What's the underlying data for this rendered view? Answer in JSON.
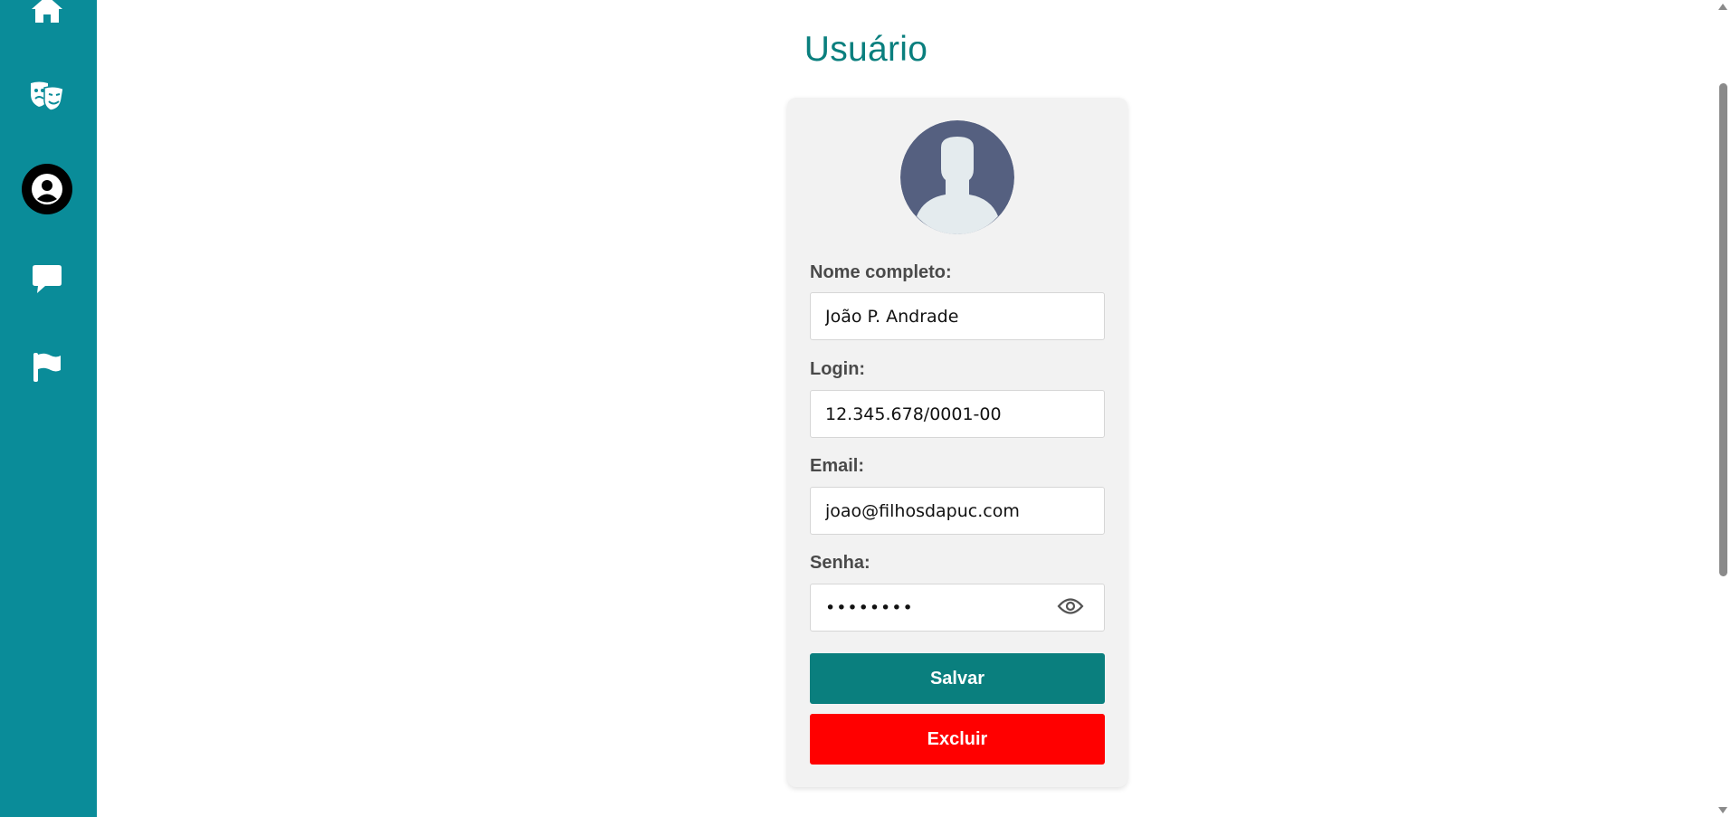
{
  "colors": {
    "sidebar": "#0a8c99",
    "accent": "#0a7f7e",
    "danger": "#ff0000",
    "card": "#f2f2f2",
    "avatar_bg": "#556080",
    "avatar_figure": "#e4ebee"
  },
  "sidebar": {
    "items": [
      {
        "icon": "home-icon",
        "active": false
      },
      {
        "icon": "theater-masks-icon",
        "active": false
      },
      {
        "icon": "user-circle-icon",
        "active": true
      },
      {
        "icon": "chat-bubble-icon",
        "active": false
      },
      {
        "icon": "flag-icon",
        "active": false
      }
    ]
  },
  "page": {
    "title": "Usuário"
  },
  "form": {
    "avatar_icon": "user-silhouette-icon",
    "name": {
      "label": "Nome completo:",
      "value": "João P. Andrade"
    },
    "login": {
      "label": "Login:",
      "value": "12.345.678/0001-00"
    },
    "email": {
      "label": "Email:",
      "value": "joao@filhosdapuc.com"
    },
    "password": {
      "label": "Senha:",
      "value": "••••••••",
      "toggle_icon": "eye-icon"
    },
    "save_label": "Salvar",
    "delete_label": "Excluir"
  }
}
